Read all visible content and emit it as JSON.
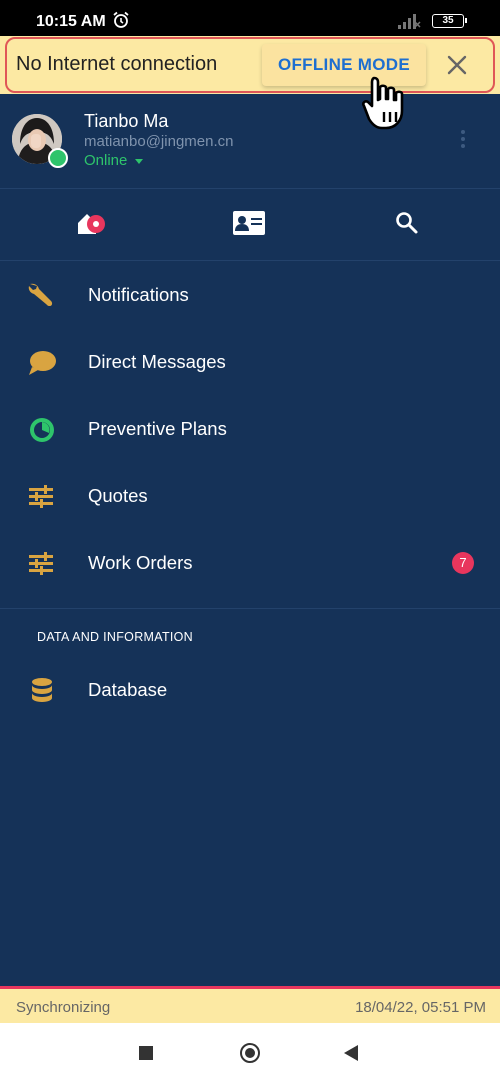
{
  "status_bar": {
    "time": "10:15 AM",
    "battery": "35"
  },
  "banner": {
    "message": "No Internet connection",
    "action": "OFFLINE MODE"
  },
  "profile": {
    "name": "Tianbo Ma",
    "email": "matianbo@jingmen.cn",
    "status": "Online"
  },
  "tabs": [
    {
      "icon": "home-icon"
    },
    {
      "icon": "contact-card-icon"
    },
    {
      "icon": "search-icon"
    }
  ],
  "menu": {
    "items": [
      {
        "label": "Notifications",
        "icon": "wrench-icon",
        "icon_color": "#d9a441"
      },
      {
        "label": "Direct Messages",
        "icon": "chat-bubble-icon",
        "icon_color": "#d9a441"
      },
      {
        "label": "Preventive Plans",
        "icon": "clock-progress-icon",
        "icon_color": "#2ec46b"
      },
      {
        "label": "Quotes",
        "icon": "sliders-icon",
        "icon_color": "#d9a441"
      },
      {
        "label": "Work Orders",
        "icon": "sliders-icon",
        "icon_color": "#d9a441",
        "badge": "7"
      }
    ],
    "section_title": "DATA AND INFORMATION",
    "section_items": [
      {
        "label": "Database",
        "icon": "database-icon",
        "icon_color": "#d9a441"
      }
    ]
  },
  "sync": {
    "status": "Synchronizing",
    "timestamp": "18/04/22, 05:51 PM"
  },
  "colors": {
    "background": "#153258",
    "banner": "#fce9a3",
    "accent_red": "#e8365d",
    "online_green": "#2ec46b",
    "icon_gold": "#d9a441",
    "link_blue": "#1e6fd0"
  }
}
